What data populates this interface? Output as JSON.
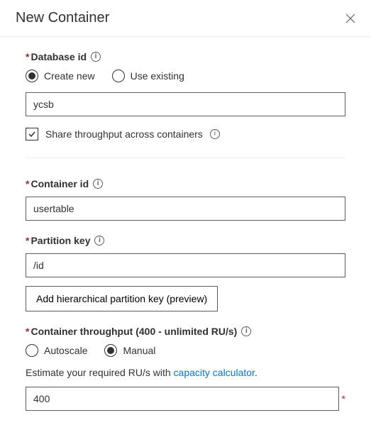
{
  "header": {
    "title": "New Container"
  },
  "databaseId": {
    "label": "Database id",
    "createNewLabel": "Create new",
    "useExistingLabel": "Use existing",
    "value": "ycsb",
    "shareThroughputLabel": "Share throughput across containers"
  },
  "containerId": {
    "label": "Container id",
    "value": "usertable"
  },
  "partitionKey": {
    "label": "Partition key",
    "value": "/id",
    "hierarchicalButton": "Add hierarchical partition key (preview)"
  },
  "throughput": {
    "label": "Container throughput (400 - unlimited RU/s)",
    "autoscaleLabel": "Autoscale",
    "manualLabel": "Manual",
    "estimatePrefix": "Estimate your required RU/s with ",
    "estimateLink": "capacity calculator",
    "estimateSuffix": ".",
    "value": "400"
  }
}
